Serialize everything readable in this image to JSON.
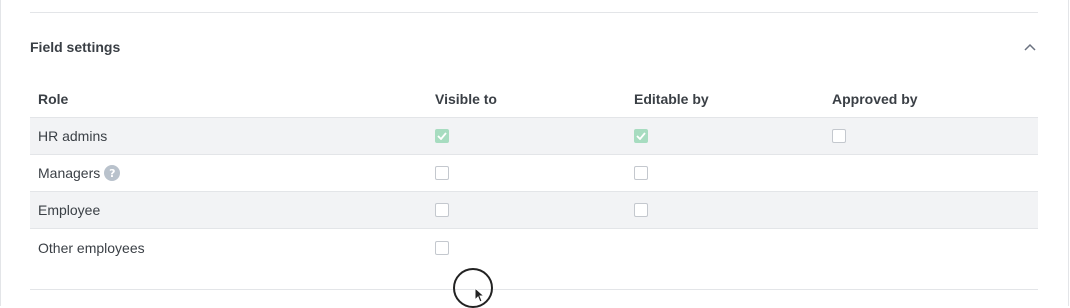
{
  "section": {
    "title": "Field settings",
    "collapse_icon": "chevron-up-icon"
  },
  "table": {
    "columns": [
      "Role",
      "Visible to",
      "Editable by",
      "Approved by"
    ],
    "rows": [
      {
        "role": "HR admins",
        "visible_to": true,
        "editable_by": true,
        "approved_by": false,
        "shaded": true,
        "help": false
      },
      {
        "role": "Managers",
        "visible_to": false,
        "editable_by": false,
        "approved_by": null,
        "shaded": false,
        "help": true
      },
      {
        "role": "Employee",
        "visible_to": false,
        "editable_by": false,
        "approved_by": null,
        "shaded": true,
        "help": false
      },
      {
        "role": "Other employees",
        "visible_to": false,
        "editable_by": null,
        "approved_by": null,
        "shaded": false,
        "help": false
      }
    ],
    "help_glyph": "?"
  },
  "colors": {
    "checked": "#a7dcc0",
    "border": "#c4c8ce",
    "row_shade": "#f2f3f5",
    "help_icon": "#b9c2cc"
  }
}
